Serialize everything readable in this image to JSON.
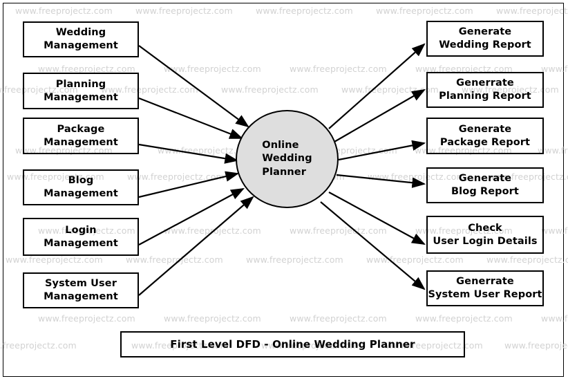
{
  "diagram": {
    "title": "First Level DFD - Online Wedding Planner",
    "process": {
      "name": "process-node",
      "label": "Online\nWedding\nPlanner",
      "fill_color": "#dedede",
      "stroke_color": "#000000"
    },
    "inputs": [
      {
        "id": "wedding-management",
        "label": "Wedding\nManagement"
      },
      {
        "id": "planning-management",
        "label": "Planning\nManagement"
      },
      {
        "id": "package-management",
        "label": "Package\nManagement"
      },
      {
        "id": "blog-management",
        "label": "Blog\nManagement"
      },
      {
        "id": "login-management",
        "label": "Login\nManagement"
      },
      {
        "id": "system-user-management",
        "label": "System User\nManagement"
      }
    ],
    "outputs": [
      {
        "id": "generate-wedding-report",
        "label": "Generate\nWedding Report"
      },
      {
        "id": "generate-planning-report",
        "label": "Generrate\nPlanning Report"
      },
      {
        "id": "generate-package-report",
        "label": "Generate\nPackage Report"
      },
      {
        "id": "generate-blog-report",
        "label": "Generate\nBlog Report"
      },
      {
        "id": "check-user-login-details",
        "label": "Check\nUser Login Details"
      },
      {
        "id": "generate-system-user-report",
        "label": "Generrate\nSystem User Report"
      }
    ],
    "flows": [
      {
        "from": "wedding-management",
        "to": "process-node",
        "direction": "in"
      },
      {
        "from": "planning-management",
        "to": "process-node",
        "direction": "in"
      },
      {
        "from": "package-management",
        "to": "process-node",
        "direction": "in"
      },
      {
        "from": "blog-management",
        "to": "process-node",
        "direction": "in"
      },
      {
        "from": "login-management",
        "to": "process-node",
        "direction": "in"
      },
      {
        "from": "system-user-management",
        "to": "process-node",
        "direction": "in"
      },
      {
        "from": "process-node",
        "to": "generate-wedding-report",
        "direction": "out"
      },
      {
        "from": "process-node",
        "to": "generate-planning-report",
        "direction": "out"
      },
      {
        "from": "process-node",
        "to": "generate-package-report",
        "direction": "out"
      },
      {
        "from": "process-node",
        "to": "generate-blog-report",
        "direction": "out"
      },
      {
        "from": "process-node",
        "to": "check-user-login-details",
        "direction": "out"
      },
      {
        "from": "process-node",
        "to": "generate-system-user-report",
        "direction": "out"
      }
    ]
  },
  "watermark": {
    "text": "www.freeprojectz.com",
    "color": "#d2d2d2"
  }
}
